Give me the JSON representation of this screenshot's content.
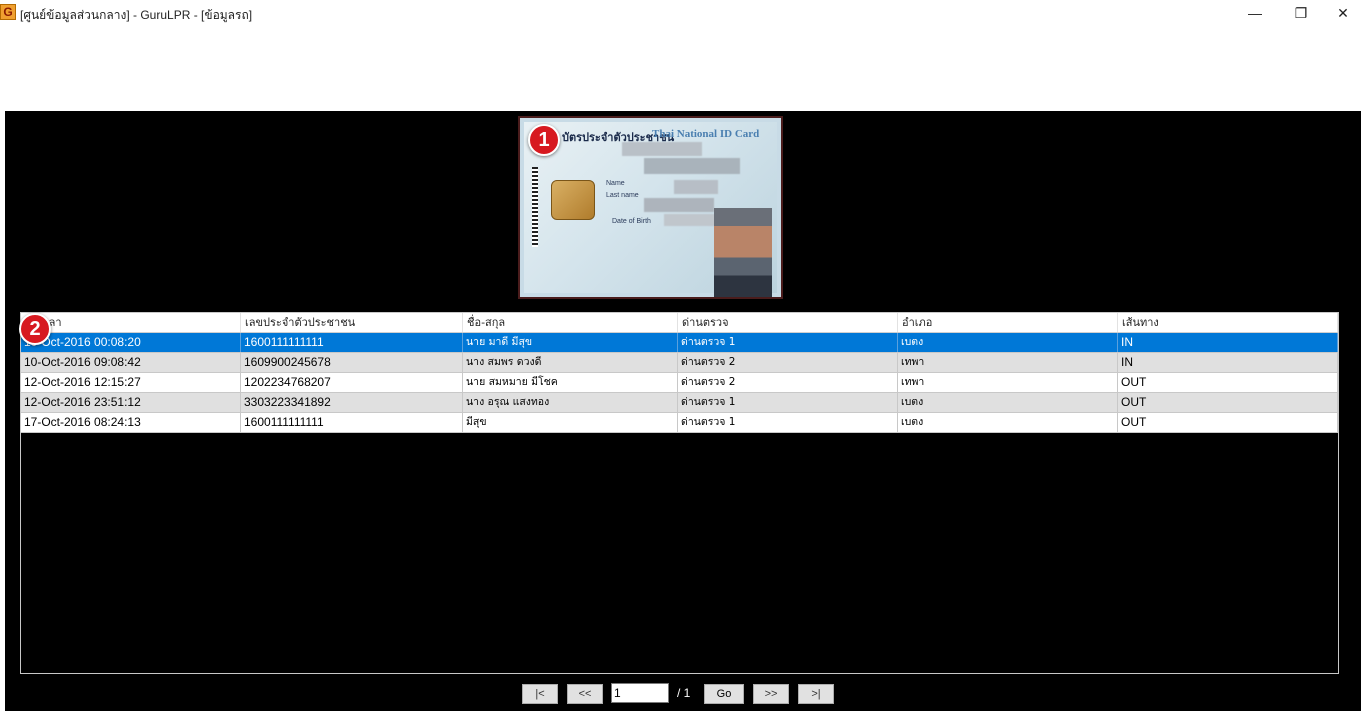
{
  "window": {
    "app_icon_letter": "G",
    "title": "[ศูนย์ข้อมูลส่วนกลาง] - GuruLPR - [ข้อมูลรถ]",
    "minimize_glyph": "—",
    "maximize_glyph": "❐",
    "close_glyph": "✕"
  },
  "card": {
    "badge": "1",
    "title_th": "บัตรประจำตัวประชาชน",
    "title_en": "Thai National ID Card",
    "label_name": "Name",
    "label_lastname": "Last name",
    "label_dob": "Date of Birth"
  },
  "grid": {
    "badge": "2",
    "columns": [
      "วันเวลา",
      "เลขประจำตัวประชาชน",
      "ชื่อ-สกุล",
      "ด่านตรวจ",
      "อำเภอ",
      "เส้นทาง"
    ],
    "rows": [
      [
        "10-Oct-2016 00:08:20",
        "1600111111111",
        "นาย มาดี มีสุข",
        "ด่านตรวจ 1",
        "เบตง",
        "IN"
      ],
      [
        "10-Oct-2016 09:08:42",
        "1609900245678",
        "นาง สมพร ดวงดี",
        "ด่านตรวจ 2",
        "เทพา",
        "IN"
      ],
      [
        "12-Oct-2016 12:15:27",
        "1202234768207",
        "นาย สมหมาย มีโชค",
        "ด่านตรวจ 2",
        "เทพา",
        "OUT"
      ],
      [
        "12-Oct-2016 23:51:12",
        "3303223341892",
        "นาง อรุณ แสงทอง",
        "ด่านตรวจ 1",
        "เบตง",
        "OUT"
      ],
      [
        "17-Oct-2016 08:24:13",
        "1600111111111",
        "มีสุข",
        "ด่านตรวจ 1",
        "เบตง",
        "OUT"
      ]
    ],
    "selected_row": 0
  },
  "pager": {
    "first_label": "|<",
    "prev_label": "<<",
    "current_page": "1",
    "total_label": "/ 1",
    "go_label": "Go",
    "next_label": ">>",
    "last_label": ">|"
  },
  "colors": {
    "selection": "#0078d7",
    "panel_background": "#000000",
    "badge_red": "#d71920"
  }
}
